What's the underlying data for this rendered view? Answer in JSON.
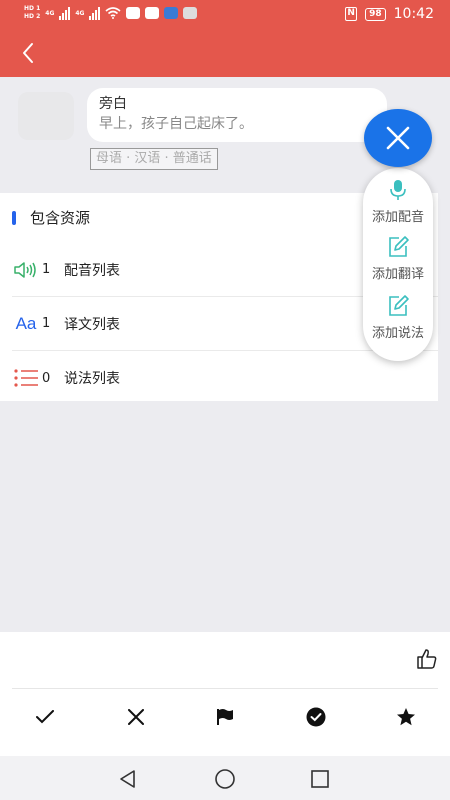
{
  "status_bar": {
    "sim1": "HD 1",
    "sim2": "HD 2",
    "net1": "4G",
    "net2": "4G",
    "nfc": "N",
    "battery": "98",
    "time": "10:42"
  },
  "header": {
    "back_icon": "chevron-left-icon"
  },
  "narration": {
    "role": "旁白",
    "text": "早上，孩子自己起床了。",
    "language_tag": "母语 · 汉语 · 普通话"
  },
  "resources": {
    "title": "包含资源",
    "items": [
      {
        "icon": "speaker-icon",
        "count": "1",
        "label": "配音列表"
      },
      {
        "icon": "translate-icon",
        "count": "1",
        "label": "译文列表"
      },
      {
        "icon": "list-icon",
        "count": "0",
        "label": "说法列表"
      }
    ]
  },
  "fab_menu": {
    "close_icon": "close-icon",
    "items": [
      {
        "icon": "microphone-icon",
        "label": "添加配音"
      },
      {
        "icon": "edit-icon",
        "label": "添加翻译"
      },
      {
        "icon": "edit-icon",
        "label": "添加说法"
      }
    ]
  },
  "bottom_actions": [
    "check-icon",
    "close-icon",
    "flag-icon",
    "check-circle-icon",
    "star-icon"
  ],
  "colors": {
    "header": "#e4574c",
    "accent": "#1a73e8",
    "teal_icon": "#3bbfbf",
    "green_icon": "#38b16a",
    "list_icon": "#e4574c"
  }
}
